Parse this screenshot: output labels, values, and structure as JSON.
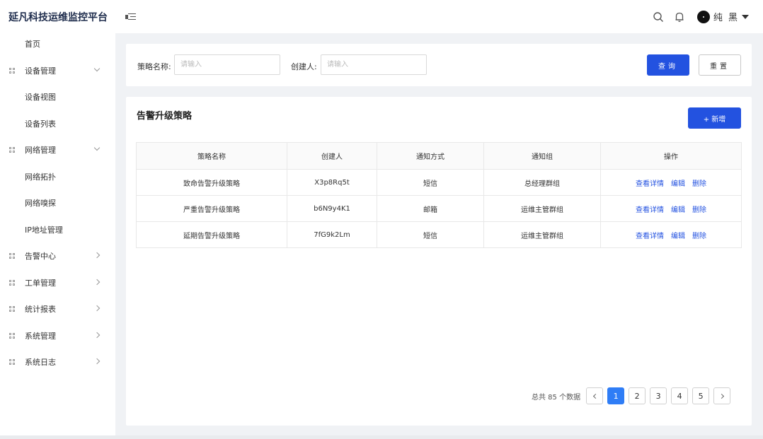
{
  "header": {
    "brand": "延凡科技运维监控平台",
    "username": "纯 黑"
  },
  "sidebar": {
    "items": [
      {
        "label": "首页",
        "type": "sub"
      },
      {
        "label": "设备管理",
        "type": "group",
        "chevron": "down"
      },
      {
        "label": "设备视图",
        "type": "sub"
      },
      {
        "label": "设备列表",
        "type": "sub"
      },
      {
        "label": "网络管理",
        "type": "group",
        "chevron": "down"
      },
      {
        "label": "网络拓扑",
        "type": "sub"
      },
      {
        "label": "网络嗅探",
        "type": "sub"
      },
      {
        "label": "IP地址管理",
        "type": "sub"
      },
      {
        "label": "告警中心",
        "type": "group",
        "chevron": "right"
      },
      {
        "label": "工单管理",
        "type": "group",
        "chevron": "right"
      },
      {
        "label": "统计报表",
        "type": "group",
        "chevron": "right"
      },
      {
        "label": "系统管理",
        "type": "group",
        "chevron": "right"
      },
      {
        "label": "系统日志",
        "type": "group",
        "chevron": "right"
      }
    ]
  },
  "search": {
    "name_label": "策略名称:",
    "name_placeholder": "请输入",
    "name_value": "",
    "creator_label": "创建人:",
    "creator_placeholder": "请输入",
    "creator_value": "",
    "query_label": "查询",
    "reset_label": "重置"
  },
  "table": {
    "title": "告警升级策略",
    "add_label": "+ 新增",
    "columns": [
      "策略名称",
      "创建人",
      "通知方式",
      "通知组",
      "操作"
    ],
    "rows": [
      {
        "name": "致命告警升级策略",
        "creator": "X3p8Rq5t",
        "method": "短信",
        "group": "总经理群组"
      },
      {
        "name": "严重告警升级策略",
        "creator": "b6N9y4K1",
        "method": "邮箱",
        "group": "运维主管群组"
      },
      {
        "name": "延期告警升级策略",
        "creator": "7fG9k2Lm",
        "method": "短信",
        "group": "运维主管群组"
      }
    ],
    "actions": {
      "view": "查看详情",
      "edit": "编辑",
      "delete": "删除"
    }
  },
  "pagination": {
    "total_text": "总共 85 个数据",
    "pages": [
      "1",
      "2",
      "3",
      "4",
      "5"
    ],
    "current": "1"
  },
  "colors": {
    "primary": "#2352e0",
    "page_active": "#2f7df6",
    "brand_text": "#1f2d4d"
  }
}
